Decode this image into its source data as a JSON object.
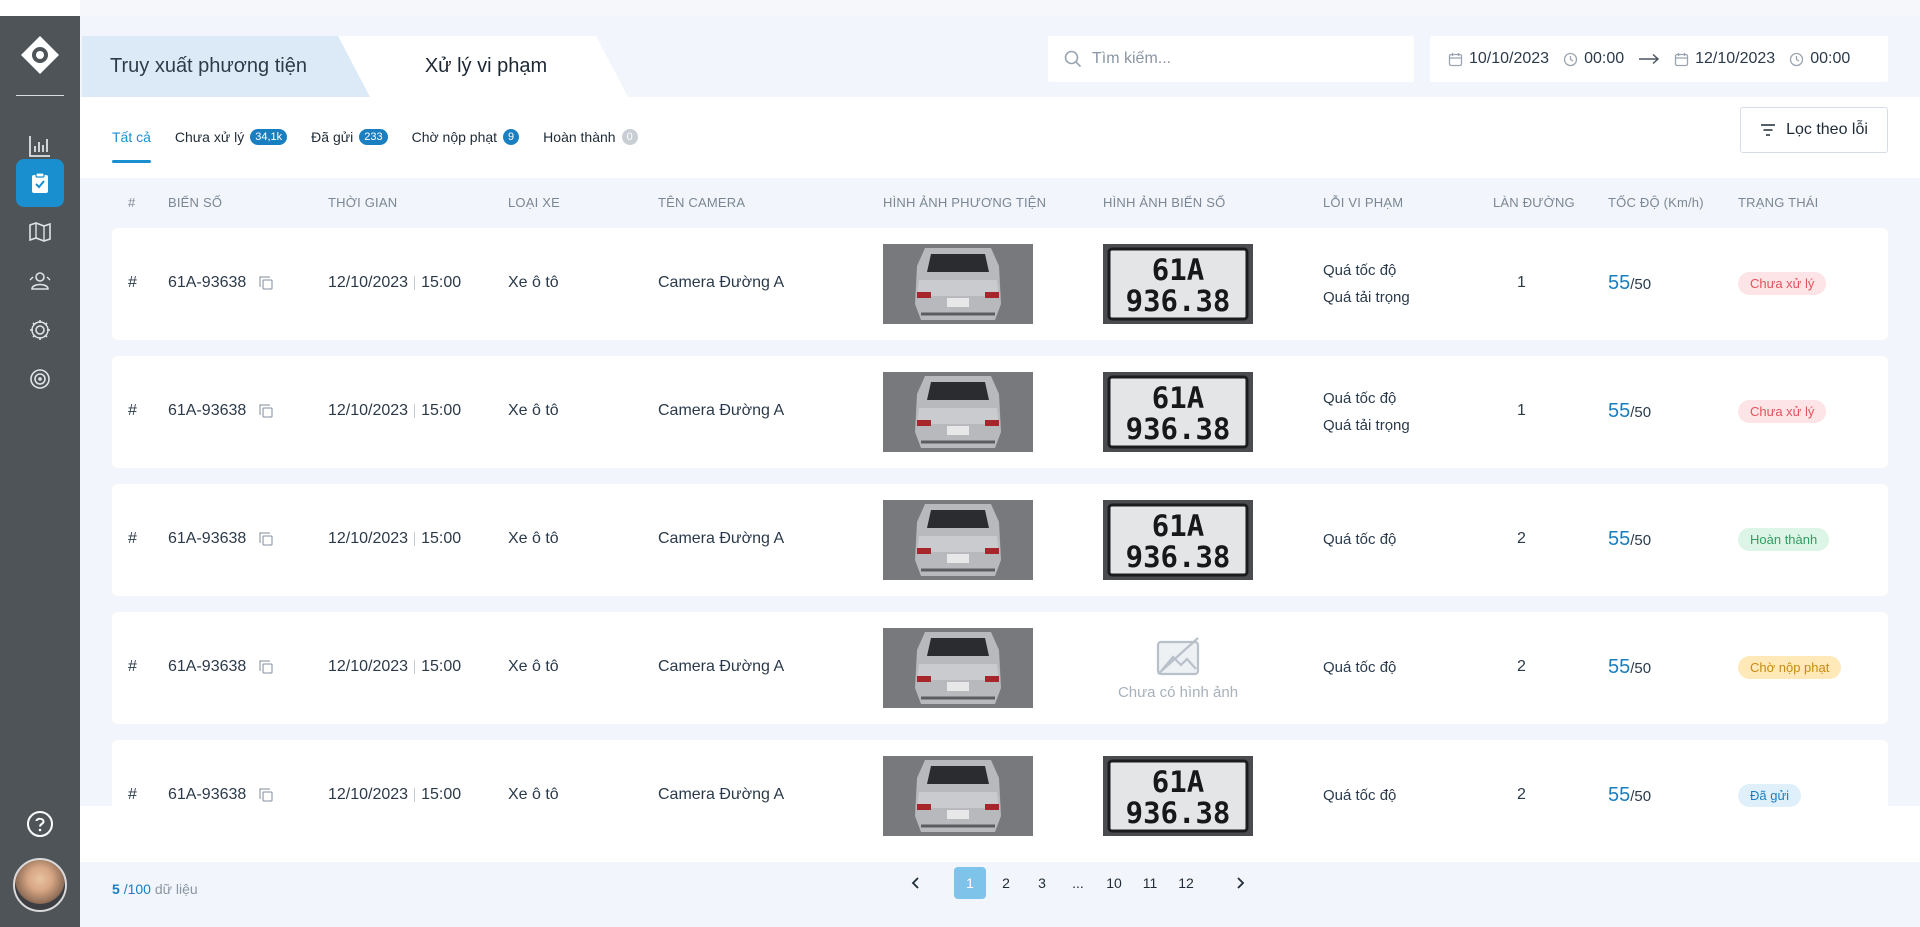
{
  "header": {
    "tabs": [
      {
        "label": "Truy xuất phương tiện"
      },
      {
        "label": "Xử lý vi phạm"
      }
    ],
    "search": {
      "placeholder": "Tìm kiếm..."
    },
    "date_range": {
      "start_date": "10/10/2023",
      "start_time": "00:00",
      "end_date": "12/10/2023",
      "end_time": "00:00"
    }
  },
  "status_tabs": [
    {
      "label": "Tất cả",
      "count": ""
    },
    {
      "label": "Chưa xử lý",
      "count": "34,1k"
    },
    {
      "label": "Đã gửi",
      "count": "233"
    },
    {
      "label": "Chờ nộp phạt",
      "count": "9"
    },
    {
      "label": "Hoàn thành",
      "count": "0"
    }
  ],
  "filter_button": {
    "label": "Lọc theo lỗi"
  },
  "table": {
    "columns": [
      "#",
      "BIỂN SỐ",
      "THỜI GIAN",
      "LOẠI XE",
      "TÊN CAMERA",
      "HÌNH ẢNH PHƯƠNG TIỆN",
      "HÌNH ẢNH BIỂN SỐ",
      "LỖI VI PHẠM",
      "LÀN ĐƯỜNG",
      "TỐC ĐỘ (Km/h)",
      "TRẠNG THÁI"
    ],
    "plate_text": [
      "61A",
      "936.38"
    ],
    "no_image_text": "Chưa có hình ảnh",
    "rows": [
      {
        "index": "#",
        "plate": "61A-93638",
        "date": "12/10/2023",
        "time": "15:00",
        "vehicle": "Xe ô tô",
        "camera": "Camera Đường A",
        "violation1": "Quá tốc độ",
        "violation2": "Quá tải trọng",
        "lane": "1",
        "speed": "55",
        "limit": "/50",
        "status": "Chưa xử lý"
      },
      {
        "index": "#",
        "plate": "61A-93638",
        "date": "12/10/2023",
        "time": "15:00",
        "vehicle": "Xe ô tô",
        "camera": "Camera Đường A",
        "violation1": "Quá tốc độ",
        "violation2": "Quá tải trọng",
        "lane": "1",
        "speed": "55",
        "limit": "/50",
        "status": "Chưa xử lý"
      },
      {
        "index": "#",
        "plate": "61A-93638",
        "date": "12/10/2023",
        "time": "15:00",
        "vehicle": "Xe ô tô",
        "camera": "Camera Đường A",
        "violation1": "Quá tốc độ",
        "violation2": "",
        "lane": "2",
        "speed": "55",
        "limit": "/50",
        "status": "Hoàn thành"
      },
      {
        "index": "#",
        "plate": "61A-93638",
        "date": "12/10/2023",
        "time": "15:00",
        "vehicle": "Xe ô tô",
        "camera": "Camera Đường A",
        "violation1": "Quá tốc độ",
        "violation2": "",
        "lane": "2",
        "speed": "55",
        "limit": "/50",
        "status": "Chờ nộp phạt"
      },
      {
        "index": "#",
        "plate": "61A-93638",
        "date": "12/10/2023",
        "time": "15:00",
        "vehicle": "Xe ô tô",
        "camera": "Camera Đường A",
        "violation1": "Quá tốc độ",
        "violation2": "",
        "lane": "2",
        "speed": "55",
        "limit": "/50",
        "status": "Đã gửi"
      }
    ]
  },
  "footer": {
    "shown": "5",
    "total": "/100",
    "suffix": "dữ liệu"
  },
  "pagination": {
    "pages": [
      "1",
      "2",
      "3",
      "...",
      "10",
      "11",
      "12"
    ],
    "current": "1"
  },
  "sidebar": {
    "icons": [
      "logo-icon",
      "chart-icon",
      "clipboard-check-icon",
      "map-icon",
      "users-icon",
      "gear-icon",
      "camera-lens-icon",
      "help-icon"
    ]
  },
  "colors": {
    "accent": "#1a8fd0",
    "sidebar": "#4f5459",
    "status_pending": "#fde4e6",
    "status_done": "#dcf5e7",
    "status_waiting": "#ffe9b8",
    "status_sent": "#dff0fb"
  }
}
